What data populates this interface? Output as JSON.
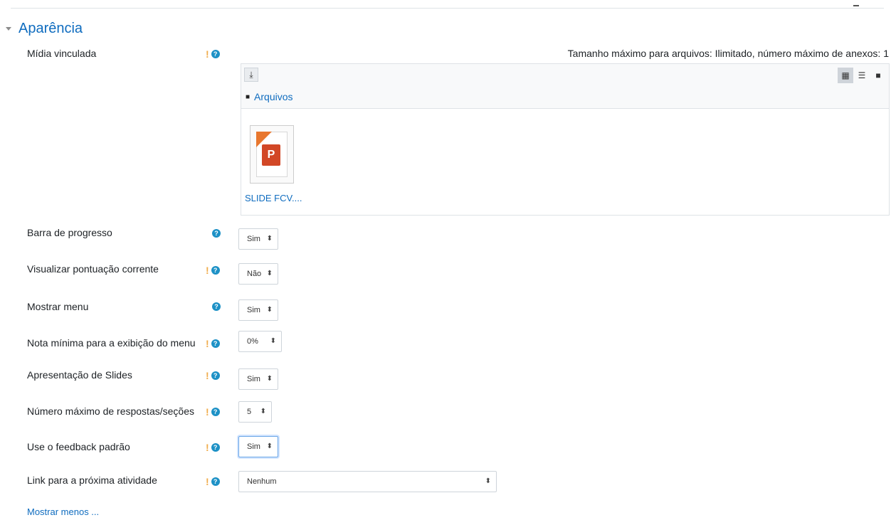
{
  "section": {
    "title": "Aparência"
  },
  "media": {
    "label": "Mídia vinculada",
    "file_limit": "Tamanho máximo para arquivos: Ilimitado, número máximo de anexos: 1",
    "path_label": "Arquivos",
    "file_name": "SLIDE FCV...."
  },
  "fields": [
    {
      "label": "Barra de progresso",
      "value": "Sim"
    },
    {
      "label": "Visualizar pontuação corrente",
      "value": "Não"
    },
    {
      "label": "Mostrar menu",
      "value": "Sim"
    },
    {
      "label": "Nota mínima para a exibição do menu",
      "value": "0%"
    },
    {
      "label": "Apresentação de Slides",
      "value": "Sim"
    },
    {
      "label": "Número máximo de respostas/seções",
      "value": "5"
    },
    {
      "label": "Use o feedback padrão",
      "value": "Sim"
    },
    {
      "label": "Link para a próxima atividade",
      "value": "Nenhum"
    }
  ],
  "show_less": "Mostrar menos ...",
  "icons": {
    "warning": "!",
    "help": "?"
  },
  "colors": {
    "accent": "#0f6cbf",
    "help_icon": "#1d91c6",
    "warning": "#f0ad4e"
  }
}
